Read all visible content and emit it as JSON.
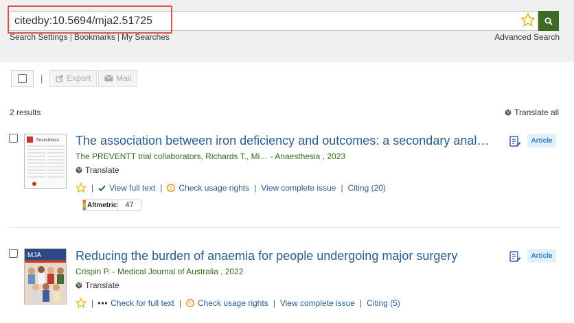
{
  "search": {
    "query": "citedby:10.5694/mja2.51725",
    "sub_links": [
      "Search Settings",
      "Bookmarks",
      "My Searches"
    ],
    "advanced_label": "Advanced Search",
    "brand_color": "#3b6b24"
  },
  "toolbar": {
    "separator": "|",
    "export_label": "Export",
    "mail_label": "Mail"
  },
  "results_header": {
    "count_text": "2 results",
    "translate_all_label": "Translate all"
  },
  "results": [
    {
      "title": "The association between iron deficiency and outcomes: a secondary anal…",
      "authors": "The PREVENTT trial collaborators, Richards T., Mi… - Anaesthesia , 2023",
      "translate_label": "Translate",
      "fulltext_label": "View full text",
      "usage_rights_label": "Check usage rights",
      "issue_label": "View complete issue",
      "citing_label": "Citing (20)",
      "badge": "Article",
      "altmetric_label": "Altmetric",
      "altmetric_score": "47",
      "thumb_label": "Anaesthesia"
    },
    {
      "title": "Reducing the burden of anaemia for people undergoing major surgery",
      "authors": "Crispin P. - Medical Journal of Australia , 2022",
      "translate_label": "Translate",
      "fulltext_label": "Check for full text",
      "usage_rights_label": "Check usage rights",
      "issue_label": "View complete issue",
      "citing_label": "Citing (5)",
      "badge": "Article",
      "thumb_label": "MJA"
    }
  ]
}
